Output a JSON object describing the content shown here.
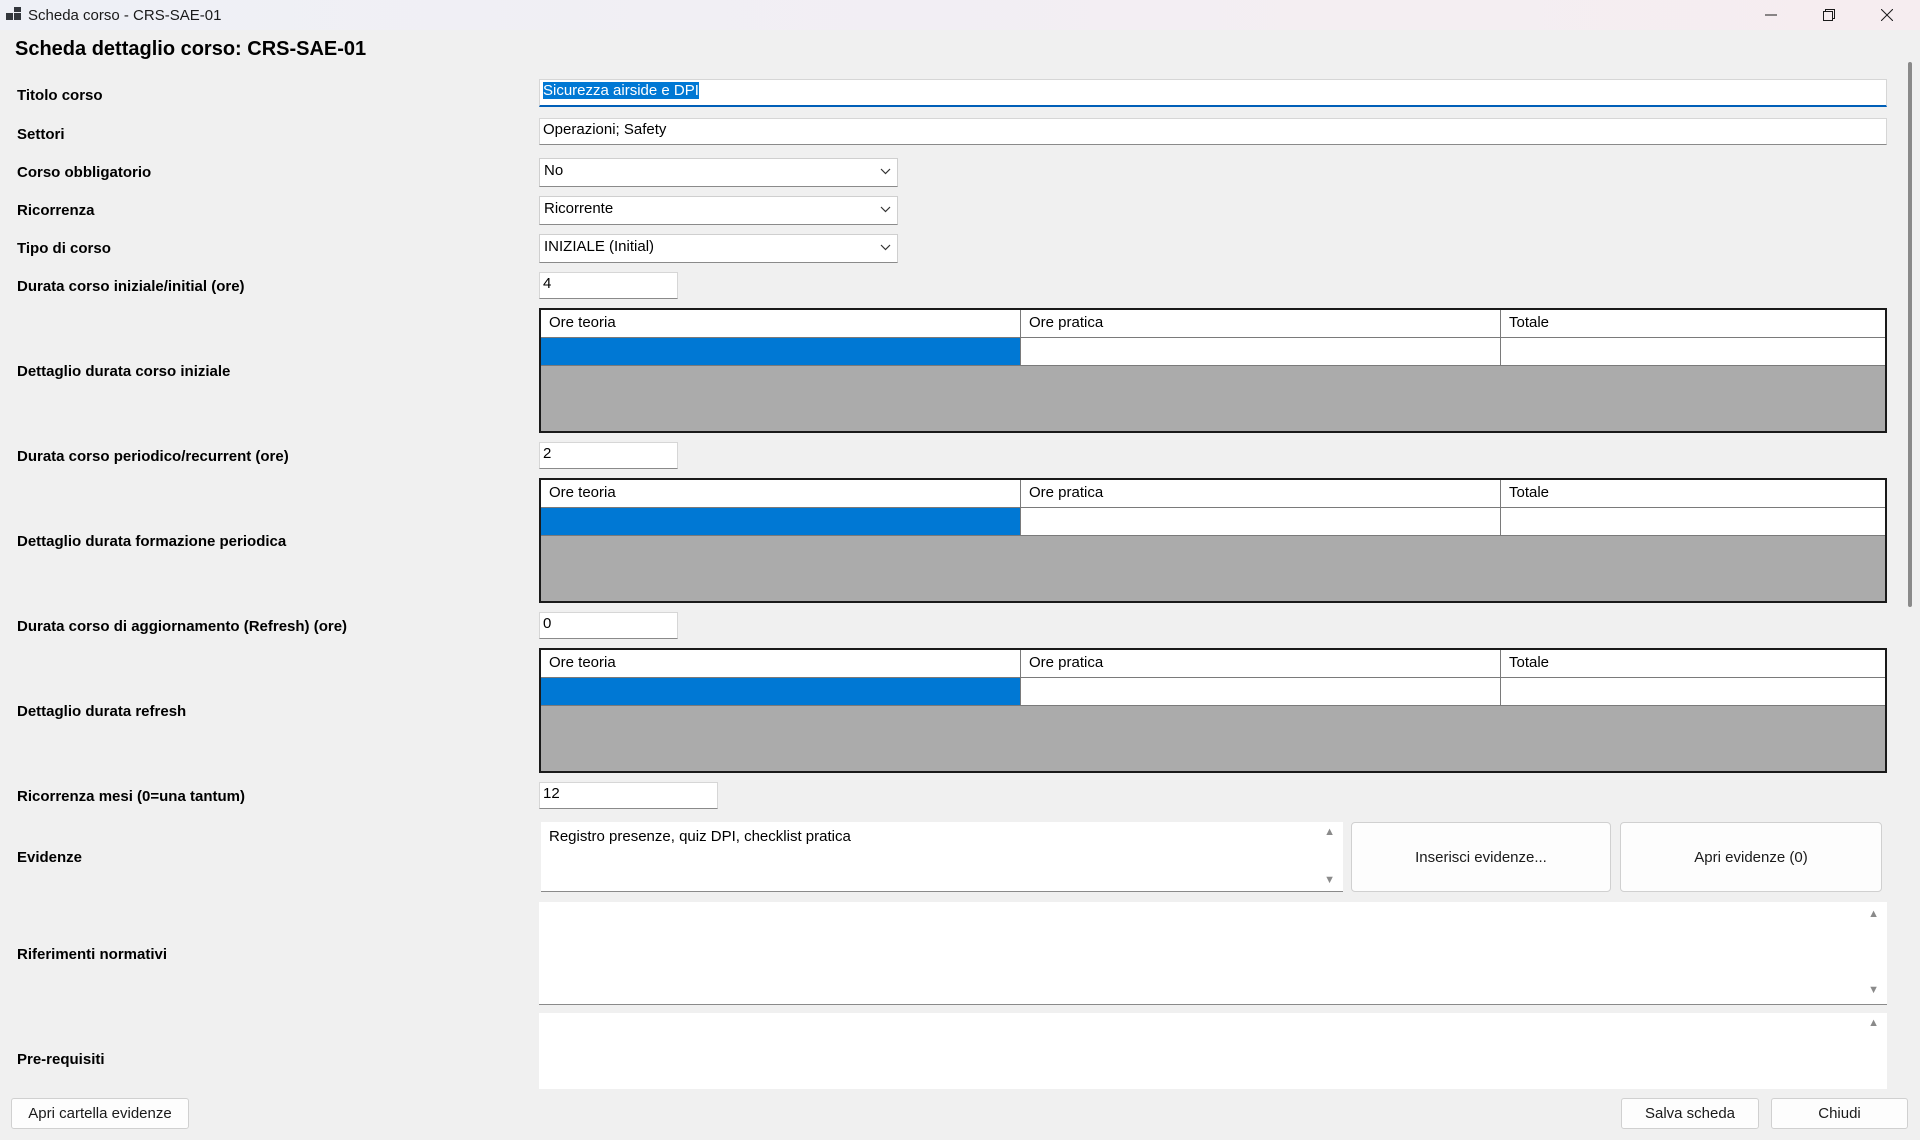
{
  "window": {
    "title": "Scheda corso - CRS-SAE-01"
  },
  "heading": "Scheda dettaglio corso: CRS-SAE-01",
  "fields": {
    "titolo": {
      "label": "Titolo corso",
      "value": "Sicurezza airside e DPI"
    },
    "settori": {
      "label": "Settori",
      "value": "Operazioni; Safety"
    },
    "obbligatorio": {
      "label": "Corso obbligatorio",
      "value": "No"
    },
    "ricorrenza": {
      "label": "Ricorrenza",
      "value": "Ricorrente"
    },
    "tipo": {
      "label": "Tipo di corso",
      "value": "INIZIALE (Initial)"
    },
    "durata_iniziale": {
      "label": "Durata corso iniziale/initial (ore)",
      "value": "4"
    },
    "dettaglio_iniziale": {
      "label": "Dettaglio durata corso iniziale"
    },
    "durata_periodico": {
      "label": "Durata corso periodico/recurrent (ore)",
      "value": "2"
    },
    "dettaglio_periodica": {
      "label": "Dettaglio durata formazione periodica"
    },
    "durata_refresh": {
      "label": "Durata corso di aggiornamento (Refresh) (ore)",
      "value": "0"
    },
    "dettaglio_refresh": {
      "label": "Dettaglio durata refresh"
    },
    "ricorrenza_mesi": {
      "label": "Ricorrenza mesi (0=una tantum)",
      "value": "12"
    },
    "evidenze": {
      "label": "Evidenze",
      "value": "Registro presenze, quiz DPI, checklist pratica"
    },
    "riferimenti": {
      "label": "Riferimenti normativi",
      "value": ""
    },
    "prerequisiti": {
      "label": "Pre-requisiti",
      "value": ""
    }
  },
  "grid_columns": [
    "Ore teoria",
    "Ore pratica",
    "Totale"
  ],
  "buttons": {
    "inserisci": "Inserisci evidenze...",
    "apri": "Apri evidenze (0)",
    "apri_cartella": "Apri cartella evidenze",
    "salva": "Salva scheda",
    "chiudi": "Chiudi"
  },
  "icons": {
    "app": "app-grid-icon",
    "minimize": "minimize-icon",
    "maximize": "restore-icon",
    "close": "close-icon",
    "dropdown": "chevron-down-icon"
  }
}
